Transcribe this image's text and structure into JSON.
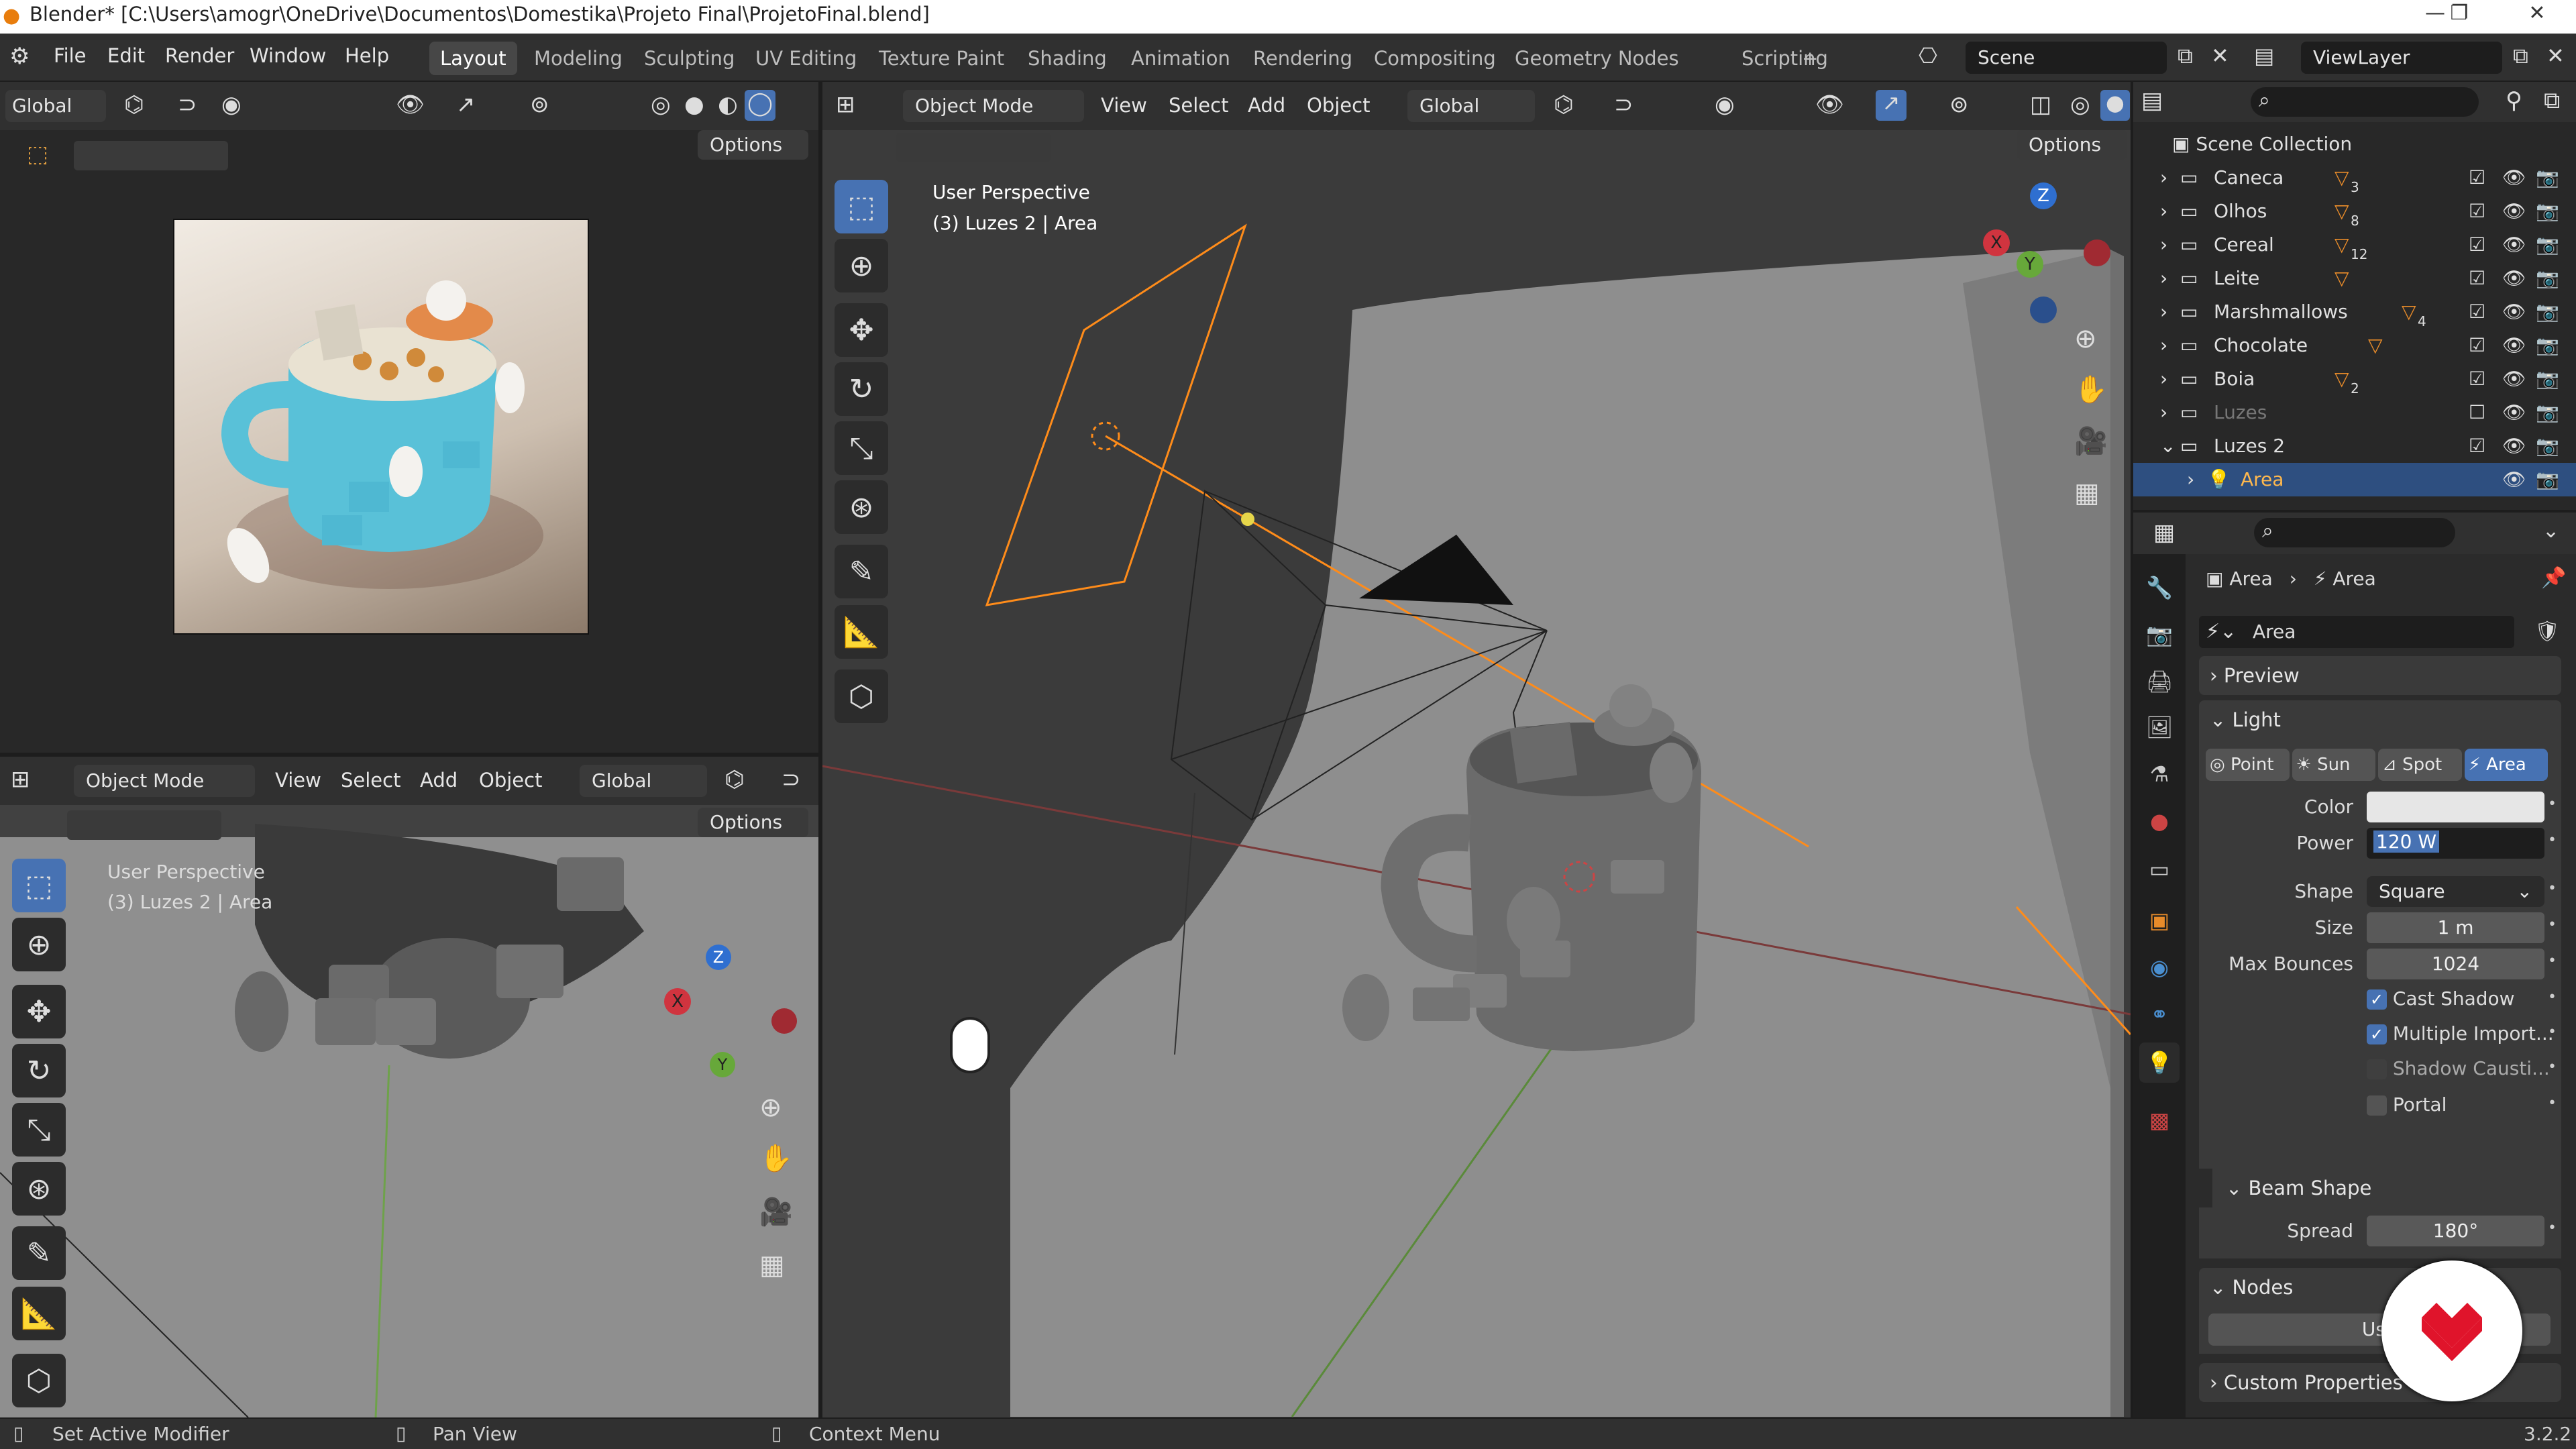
{
  "titlebar": {
    "title": "Blender* [C:\\Users\\amogr\\OneDrive\\Documentos\\Domestika\\Projeto Final\\ProjetoFinal.blend]"
  },
  "menus": [
    "File",
    "Edit",
    "Render",
    "Window",
    "Help"
  ],
  "workspaces": [
    "Layout",
    "Modeling",
    "Sculpting",
    "UV Editing",
    "Texture Paint",
    "Shading",
    "Animation",
    "Rendering",
    "Compositing",
    "Geometry Nodes",
    "Scripting",
    "+"
  ],
  "scene": "Scene",
  "viewlayer": "ViewLayer",
  "image_editor": {
    "orientation": "Global",
    "options": "Options"
  },
  "viewport_small": {
    "mode": "Object Mode",
    "menus": [
      "View",
      "Select",
      "Add",
      "Object"
    ],
    "orientation": "Global",
    "options": "Options",
    "perspective": "User Perspective",
    "active": "(3) Luzes 2 | Area"
  },
  "viewport_main": {
    "mode": "Object Mode",
    "menus": [
      "View",
      "Select",
      "Add",
      "Object"
    ],
    "orientation": "Global",
    "options": "Options",
    "perspective": "User Perspective",
    "active": "(3) Luzes 2 | Area"
  },
  "gizmo": {
    "x": "X",
    "y": "Y",
    "z": "Z"
  },
  "outliner": {
    "root": "Scene Collection",
    "items": [
      {
        "name": "Caneca",
        "count": "3"
      },
      {
        "name": "Olhos",
        "count": "8"
      },
      {
        "name": "Cereal",
        "count": "12"
      },
      {
        "name": "Leite",
        "count": ""
      },
      {
        "name": "Marshmallows",
        "count": "4"
      },
      {
        "name": "Chocolate",
        "count": ""
      },
      {
        "name": "Boia",
        "count": "2"
      },
      {
        "name": "Luzes",
        "count": ""
      },
      {
        "name": "Luzes 2",
        "count": ""
      },
      {
        "name": "Area",
        "count": ""
      }
    ]
  },
  "properties": {
    "breadcrumb_obj": "Area",
    "breadcrumb_data": "Area",
    "datablock": "Area",
    "sections": {
      "preview": "Preview",
      "light": "Light",
      "beam": "Beam Shape",
      "nodes": "Nodes",
      "custom": "Custom Properties"
    },
    "light_types": [
      "Point",
      "Sun",
      "Spot",
      "Area"
    ],
    "color_label": "Color",
    "color_value": "#e6e6e6",
    "power_label": "Power",
    "power_value": "120 W",
    "shape_label": "Shape",
    "shape_value": "Square",
    "size_label": "Size",
    "size_value": "1 m",
    "bounces_label": "Max Bounces",
    "bounces_value": "1024",
    "cast_shadow": "Cast Shadow",
    "multi_import": "Multiple Import...",
    "shadow_caustics": "Shadow Causti...",
    "portal": "Portal",
    "spread_label": "Spread",
    "spread_value": "180°",
    "use_nodes": "Use"
  },
  "status": {
    "left": "Set Active Modifier",
    "mid": "Pan View",
    "right": "Context Menu",
    "version": "3.2.2"
  },
  "colors": {
    "accent": "#4772b3",
    "light_orange": "#ff8c1a",
    "logo_red": "#e0142b"
  }
}
